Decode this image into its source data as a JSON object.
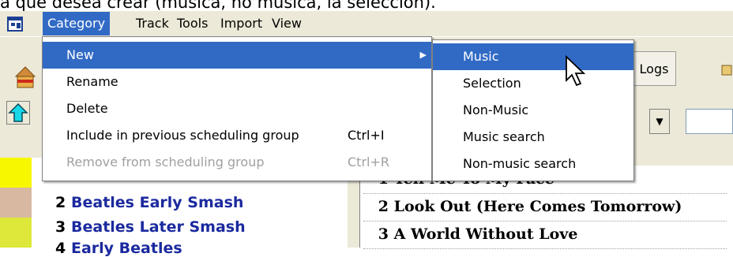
{
  "caption": "a que desea crear (música, no música, la selección).",
  "menubar": {
    "items": [
      {
        "label": "Category",
        "active": true
      },
      {
        "label": "Track"
      },
      {
        "label": "Tools"
      },
      {
        "label": "Import"
      },
      {
        "label": "View"
      }
    ]
  },
  "toolbar": {
    "logs_label": "Logs"
  },
  "category_menu": {
    "items": [
      {
        "label": "New",
        "shortcut": "",
        "highlighted": true,
        "submenu": true
      },
      {
        "label": "Rename",
        "shortcut": ""
      },
      {
        "label": "Delete",
        "shortcut": ""
      },
      {
        "label": "Include in previous scheduling group",
        "shortcut": "Ctrl+I"
      },
      {
        "label": "Remove from scheduling group",
        "shortcut": "Ctrl+R",
        "disabled": true
      }
    ]
  },
  "new_submenu": {
    "items": [
      {
        "label": "Music",
        "highlighted": true
      },
      {
        "label": "Selection"
      },
      {
        "label": "Non-Music"
      },
      {
        "label": "Music search"
      },
      {
        "label": "Non-music search"
      }
    ]
  },
  "categories": [
    {
      "num": "2",
      "name": "Beatles Early Smash"
    },
    {
      "num": "3",
      "name": "Beatles Later Smash"
    },
    {
      "num": "4",
      "name": "Early Beatles"
    }
  ],
  "tracks": [
    {
      "num": "1",
      "title": "Tell Me To My Face"
    },
    {
      "num": "2",
      "title": "Look Out (Here Comes Tomorrow)"
    },
    {
      "num": "3",
      "title": "A World Without Love"
    }
  ],
  "colors": {
    "menu_highlight": "#316ac5",
    "category_text": "#1b2a9e",
    "strip_yellow": "#f7f700",
    "strip_tan": "#d8b8a0",
    "strip_lime": "#dde83a"
  }
}
